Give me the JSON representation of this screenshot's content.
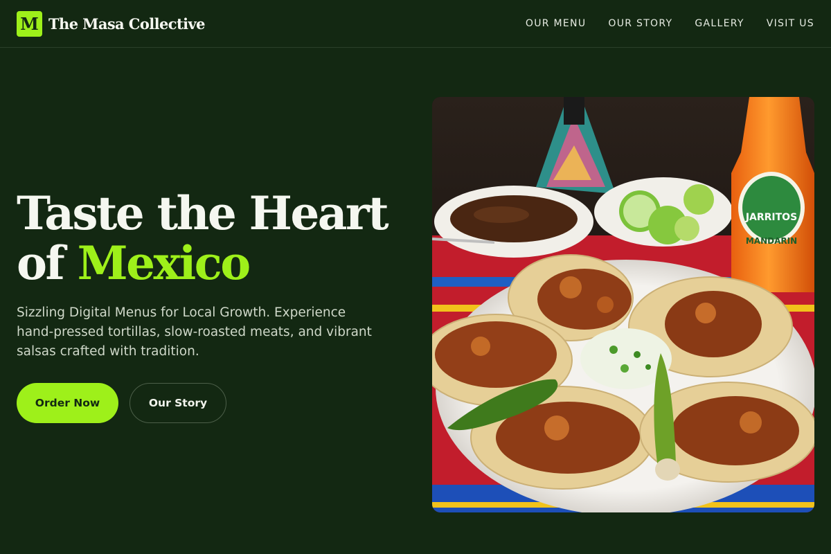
{
  "brand": {
    "logo_letter": "M",
    "name": "The Masa Collective"
  },
  "nav": {
    "links": [
      "OUR MENU",
      "OUR STORY",
      "GALLERY",
      "VISIT US"
    ]
  },
  "hero": {
    "title_line1": "Taste the Heart",
    "title_line2_prefix": "of",
    "title_accent": "Mexico",
    "subtitle": "Sizzling Digital Menus for Local Growth. Experience hand-pressed tortillas, slow-roasted meats, and vibrant salsas crafted with tradition.",
    "primary_button": "Order Now",
    "secondary_button": "Our Story"
  },
  "photo": {
    "bottle_brand": "JARRITOS",
    "bottle_flavor": "MANDARIN"
  },
  "colors": {
    "background": "#132812",
    "accent": "#9ef01a",
    "text": "#f3f5ee"
  }
}
